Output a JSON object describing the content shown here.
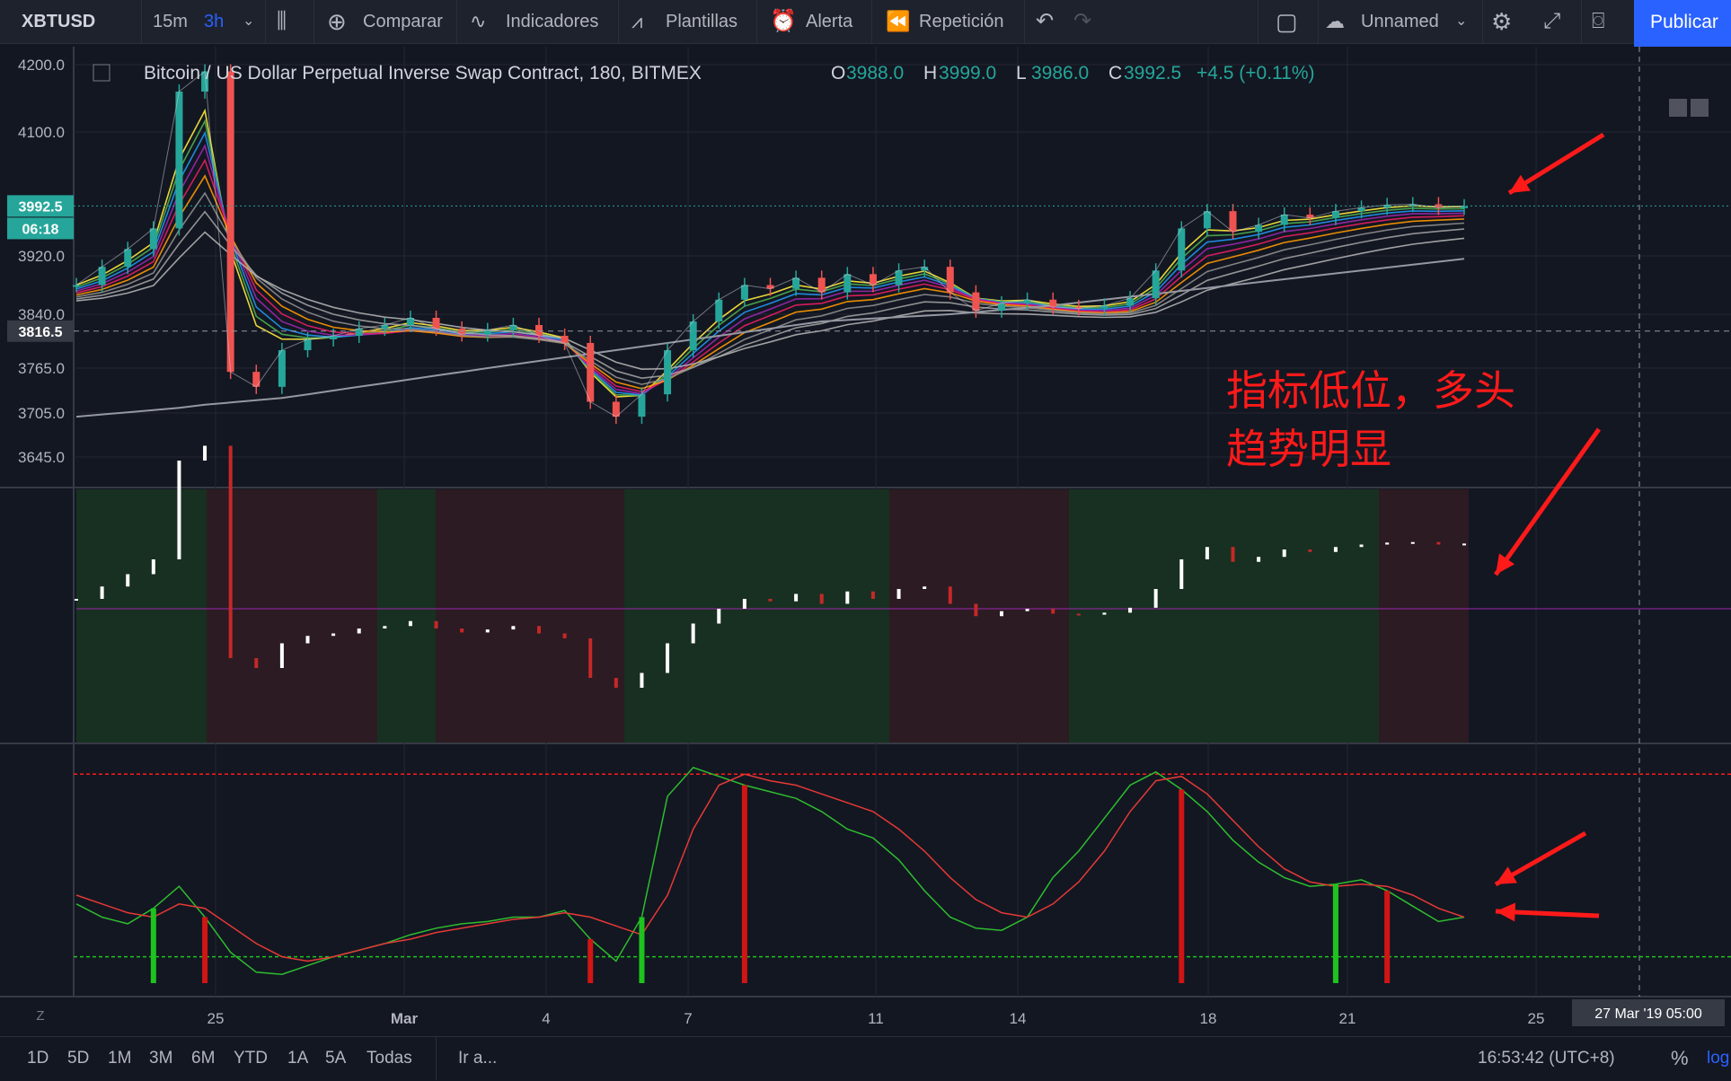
{
  "toolbar": {
    "symbol": "XBTUSD",
    "intervals": [
      "15m",
      "3h"
    ],
    "compare": "Comparar",
    "indicators": "Indicadores",
    "templates": "Plantillas",
    "alert": "Alerta",
    "replay": "Repetición",
    "layout_name": "Unnamed",
    "publish": "Publicar"
  },
  "legend": {
    "title": "Bitcoin / US Dollar Perpetual Inverse Swap Contract, 180, BITMEX",
    "o_label": "O",
    "o": "3988.0",
    "h_label": "H",
    "h": "3999.0",
    "l_label": "L",
    "l": "3986.0",
    "c_label": "C",
    "c": "3992.5",
    "change": "+4.5 (+0.11%)"
  },
  "price_tags": {
    "last": "3992.5",
    "countdown": "06:18",
    "crosshair": "3816.5"
  },
  "annotation": {
    "line1": "指标低位，多头",
    "line2": "趋势明显"
  },
  "bottom": {
    "ranges": [
      "1D",
      "5D",
      "1M",
      "3M",
      "6M",
      "YTD",
      "1A",
      "5A",
      "Todas"
    ],
    "goto": "Ir a...",
    "time": "16:53:42 (UTC+8)",
    "percent": "%",
    "log": "log"
  },
  "x_crosshair_label": "27 Mar '19   05:00",
  "colors": {
    "up": "#26a69a",
    "down": "#ef5350",
    "bg": "#131722",
    "arrow": "#ff1a1a"
  },
  "chart_data": [
    {
      "type": "line",
      "title": "Bitcoin / US Dollar Perpetual Inverse Swap Contract, 180, BITMEX",
      "x_ticks": [
        "25",
        "Mar",
        "4",
        "7",
        "11",
        "14",
        "18",
        "21",
        "25"
      ],
      "y_ticks": [
        4200.0,
        4100.0,
        3920.0,
        3840.0,
        3765.0,
        3705.0,
        3645.0
      ],
      "series": [
        {
          "values": [
            3880,
            3905,
            3930,
            3960,
            4160,
            4190,
            3760,
            3740,
            3790,
            3805,
            3810,
            3820,
            3825,
            3835,
            3820,
            3812,
            3818,
            3825,
            3810,
            3800,
            3720,
            3700,
            3730,
            3790,
            3830,
            3860,
            3880,
            3875,
            3890,
            3870,
            3895,
            3880,
            3900,
            3905,
            3870,
            3845,
            3855,
            3860,
            3850,
            3848,
            3852,
            3862,
            3900,
            3960,
            3985,
            3955,
            3965,
            3980,
            3975,
            3985,
            3990,
            3994,
            3995,
            3990,
            3992
          ]
        },
        {
          "values": [
            3700,
            3703,
            3706,
            3709,
            3712,
            3716,
            3719,
            3722,
            3725,
            3730,
            3735,
            3740,
            3745,
            3750,
            3755,
            3760,
            3765,
            3770,
            3775,
            3780,
            3785,
            3790,
            3795,
            3800,
            3805,
            3810,
            3815,
            3820,
            3825,
            3830,
            3832,
            3834,
            3836,
            3838,
            3840,
            3843,
            3846,
            3849,
            3852,
            3856,
            3860,
            3864,
            3868,
            3872,
            3876,
            3880,
            3884,
            3888,
            3892,
            3896,
            3900,
            3904,
            3908,
            3912,
            3916
          ]
        }
      ]
    },
    {
      "type": "line",
      "series": [
        {
          "name": "",
          "values": [
            36,
            30,
            27,
            34,
            44,
            30,
            14,
            5,
            4,
            8,
            12,
            15,
            18,
            22,
            25,
            27,
            28,
            30,
            30,
            33,
            20,
            10,
            30,
            85,
            98,
            94,
            90,
            87,
            84,
            78,
            70,
            66,
            56,
            42,
            30,
            25,
            24,
            30,
            48,
            60,
            75,
            90,
            96,
            88,
            78,
            65,
            55,
            48,
            44,
            45,
            47,
            42,
            35,
            28,
            30
          ]
        },
        {
          "name": "",
          "values": [
            40,
            36,
            32,
            30,
            36,
            34,
            26,
            18,
            12,
            10,
            12,
            15,
            18,
            20,
            23,
            25,
            27,
            29,
            30,
            32,
            30,
            26,
            22,
            40,
            70,
            90,
            95,
            92,
            90,
            86,
            82,
            78,
            70,
            60,
            48,
            38,
            32,
            30,
            36,
            46,
            60,
            78,
            92,
            94,
            86,
            74,
            62,
            52,
            46,
            44,
            45,
            44,
            40,
            34,
            30
          ]
        }
      ]
    }
  ]
}
